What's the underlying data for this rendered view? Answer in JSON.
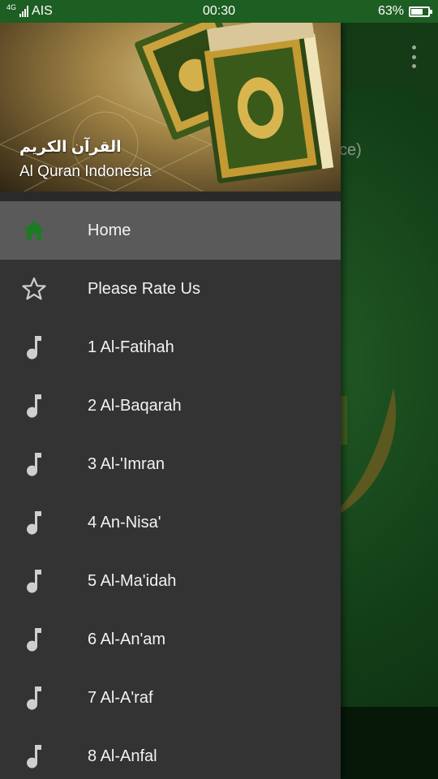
{
  "status_bar": {
    "carrier": "AIS",
    "network": "4G",
    "time": "00:30",
    "battery_percent": "63%",
    "battery_level": 0.63
  },
  "background_app": {
    "partial_text": "ce)",
    "overflow_icon": "more-vert-icon"
  },
  "drawer": {
    "header": {
      "arabic_title": "القرآن الكريم",
      "title": "Al Quran Indonesia"
    },
    "items": [
      {
        "label": "Home",
        "icon": "home-icon",
        "active": true
      },
      {
        "label": "Please Rate Us",
        "icon": "star-outline-icon",
        "active": false
      },
      {
        "label": "1 Al-Fatihah",
        "icon": "music-note-icon",
        "active": false
      },
      {
        "label": "2 Al-Baqarah",
        "icon": "music-note-icon",
        "active": false
      },
      {
        "label": "3 Al-'Imran",
        "icon": "music-note-icon",
        "active": false
      },
      {
        "label": "4 An-Nisa'",
        "icon": "music-note-icon",
        "active": false
      },
      {
        "label": "5 Al-Ma'idah",
        "icon": "music-note-icon",
        "active": false
      },
      {
        "label": "6 Al-An'am",
        "icon": "music-note-icon",
        "active": false
      },
      {
        "label": "7 Al-A'raf",
        "icon": "music-note-icon",
        "active": false
      },
      {
        "label": "8 Al-Anfal",
        "icon": "music-note-icon",
        "active": false
      }
    ]
  },
  "colors": {
    "status_bar": "#1d5e22",
    "drawer_bg": "#333333",
    "active_item_bg": "#5a5a5a",
    "home_icon": "#1f7a26",
    "icon_gray": "#cfcfcf"
  }
}
